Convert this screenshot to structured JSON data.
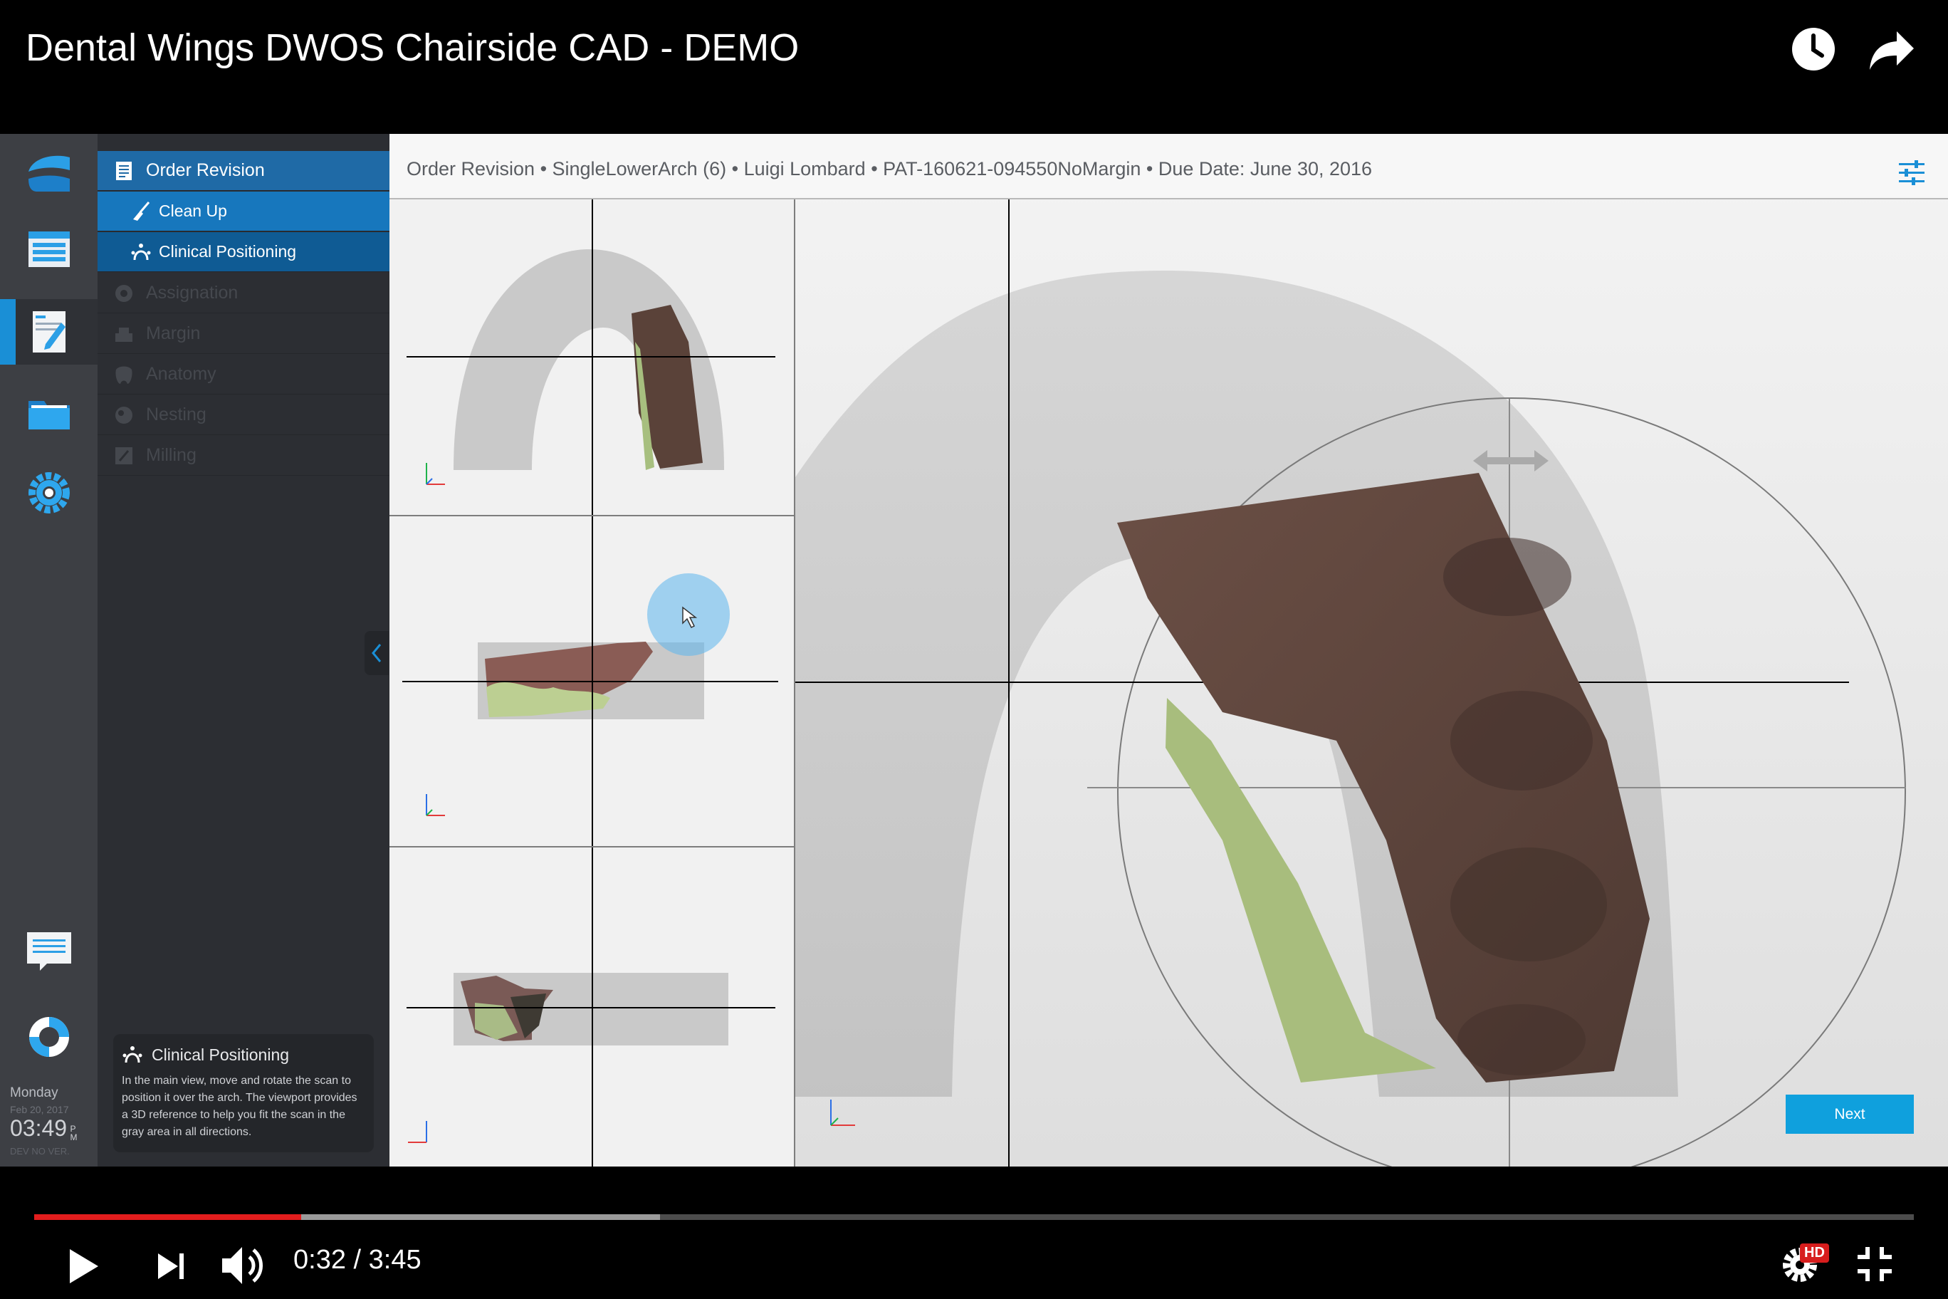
{
  "video": {
    "title": "Dental Wings DWOS Chairside CAD - DEMO",
    "time_current": "0:32",
    "time_separator": "/",
    "time_total": "3:45",
    "progress_played": 0.142,
    "progress_buffered": 0.333,
    "hd_badge": "HD"
  },
  "rail": {
    "items": [
      {
        "name": "logo",
        "icon": "dental-wings-logo-icon"
      },
      {
        "name": "dashboard",
        "icon": "dashboard-icon"
      },
      {
        "name": "order",
        "icon": "document-edit-icon"
      },
      {
        "name": "folders",
        "icon": "folder-icon"
      },
      {
        "name": "settings",
        "icon": "gear-icon"
      },
      {
        "name": "messages",
        "icon": "chat-icon"
      },
      {
        "name": "support",
        "icon": "lifebuoy-icon"
      }
    ],
    "day": "Monday",
    "date": "Feb 20, 2017",
    "time": "03:49",
    "ampm_top": "P",
    "ampm_bottom": "M",
    "version": "DEV NO VER."
  },
  "steps": [
    {
      "label": "Order Revision",
      "icon": "order-revision-icon",
      "state": "done"
    },
    {
      "label": "Clean Up",
      "icon": "broom-icon",
      "state": "sub"
    },
    {
      "label": "Clinical Positioning",
      "icon": "positioning-icon",
      "state": "current"
    },
    {
      "label": "Assignation",
      "icon": "assignation-icon",
      "state": "locked"
    },
    {
      "label": "Margin",
      "icon": "margin-icon",
      "state": "locked"
    },
    {
      "label": "Anatomy",
      "icon": "anatomy-icon",
      "state": "locked"
    },
    {
      "label": "Nesting",
      "icon": "nesting-icon",
      "state": "locked"
    },
    {
      "label": "Milling",
      "icon": "milling-icon",
      "state": "locked"
    }
  ],
  "help": {
    "title": "Clinical Positioning",
    "body": "In the main view, move and rotate the scan to position it over the arch. The viewport provides a 3D reference to help you fit the scan in the gray area in all directions."
  },
  "header": {
    "breadcrumb": "Order Revision • SingleLowerArch (6) • Luigi Lombard • PAT-160621-094550NoMargin • Due Date: June 30, 2016"
  },
  "actions": {
    "next": "Next"
  },
  "colors": {
    "accent": "#1a8fd6",
    "step_done": "#1f6aa6",
    "next_button": "#0fa0dd",
    "progress_red": "#e21d1d"
  }
}
